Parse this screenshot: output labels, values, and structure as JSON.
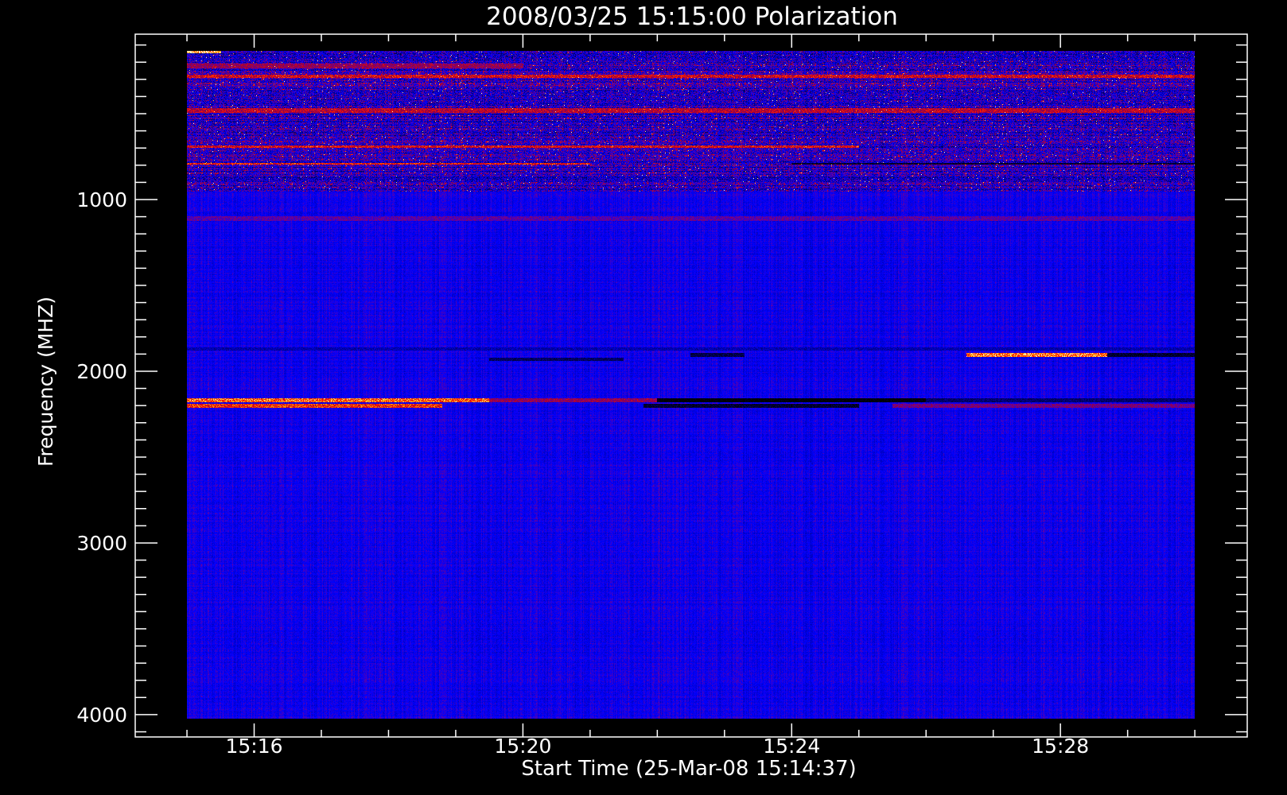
{
  "chart_data": {
    "type": "heatmap",
    "title": "2008/03/25 15:15:00 Polarization",
    "xlabel": "Start Time (25-Mar-08 15:14:37)",
    "ylabel": "Frequency (MHZ)",
    "x_units": "minutes after 15:00",
    "xlim": [
      14.23,
      30.78
    ],
    "data_time_extent": [
      15.0,
      30.0
    ],
    "x_major_ticks": [
      16,
      20,
      24,
      28
    ],
    "x_tick_labels": [
      "15:16",
      "15:20",
      "15:24",
      "15:28"
    ],
    "x_minor_step": 1,
    "ylim": [
      4130,
      37
    ],
    "data_freq_extent": [
      134,
      4023
    ],
    "y_major_ticks": [
      1000,
      2000,
      3000,
      4000
    ],
    "y_tick_labels": [
      "1000",
      "2000",
      "3000",
      "4000"
    ],
    "y_minor_step": 100,
    "colormap": [
      "#000000",
      "#000078",
      "#0000ff",
      "#6e0096",
      "#96003c",
      "#ff1400",
      "#ffa000",
      "#ffffdc"
    ],
    "colormap_levels": [
      -1,
      -0.5,
      0,
      0.3,
      0.5,
      0.7,
      0.85,
      1
    ],
    "background_level": 0,
    "noise": {
      "low_freq_below_mhz": 950,
      "low_freq_amplitude": 0.55,
      "high_freq_amplitude": 0.22
    },
    "features": [
      {
        "freq_mhz": 2170,
        "width_mhz": 25,
        "t_start": 15.0,
        "t_end": 19.5,
        "level": 0.78
      },
      {
        "freq_mhz": 2170,
        "width_mhz": 25,
        "t_start": 19.5,
        "t_end": 22.0,
        "level": 0.45
      },
      {
        "freq_mhz": 2170,
        "width_mhz": 25,
        "t_start": 22.0,
        "t_end": 26.0,
        "level": -1.0
      },
      {
        "freq_mhz": 2170,
        "width_mhz": 25,
        "t_start": 26.0,
        "t_end": 30.0,
        "level": -0.55
      },
      {
        "freq_mhz": 2200,
        "width_mhz": 25,
        "t_start": 15.0,
        "t_end": 18.8,
        "level": 0.7
      },
      {
        "freq_mhz": 2200,
        "width_mhz": 25,
        "t_start": 21.8,
        "t_end": 25.0,
        "level": -0.8
      },
      {
        "freq_mhz": 2200,
        "width_mhz": 25,
        "t_start": 25.5,
        "t_end": 30.0,
        "level": 0.35
      },
      {
        "freq_mhz": 1905,
        "width_mhz": 20,
        "t_start": 26.6,
        "t_end": 28.7,
        "level": 0.82
      },
      {
        "freq_mhz": 1905,
        "width_mhz": 20,
        "t_start": 28.7,
        "t_end": 30.0,
        "level": -0.8
      },
      {
        "freq_mhz": 1905,
        "width_mhz": 20,
        "t_start": 22.5,
        "t_end": 23.3,
        "level": -0.7
      },
      {
        "freq_mhz": 1930,
        "width_mhz": 20,
        "t_start": 19.5,
        "t_end": 21.5,
        "level": -0.6
      },
      {
        "freq_mhz": 1870,
        "width_mhz": 15,
        "t_start": 15.0,
        "t_end": 30.0,
        "level": -0.3
      },
      {
        "freq_mhz": 140,
        "width_mhz": 15,
        "t_start": 15.0,
        "t_end": 15.5,
        "level": 0.88
      },
      {
        "freq_mhz": 220,
        "width_mhz": 25,
        "t_start": 15.0,
        "t_end": 20.0,
        "level": 0.45
      },
      {
        "freq_mhz": 280,
        "width_mhz": 15,
        "t_start": 15.0,
        "t_end": 30.0,
        "level": 0.6
      },
      {
        "freq_mhz": 480,
        "width_mhz": 25,
        "t_start": 15.0,
        "t_end": 30.0,
        "level": 0.55
      },
      {
        "freq_mhz": 690,
        "width_mhz": 12,
        "t_start": 15.0,
        "t_end": 25.0,
        "level": 0.62
      },
      {
        "freq_mhz": 790,
        "width_mhz": 12,
        "t_start": 15.0,
        "t_end": 21.0,
        "level": 0.66
      },
      {
        "freq_mhz": 790,
        "width_mhz": 12,
        "t_start": 24.0,
        "t_end": 30.0,
        "level": -0.8
      },
      {
        "freq_mhz": 1110,
        "width_mhz": 30,
        "t_start": 15.0,
        "t_end": 30.0,
        "level": 0.25
      }
    ]
  }
}
